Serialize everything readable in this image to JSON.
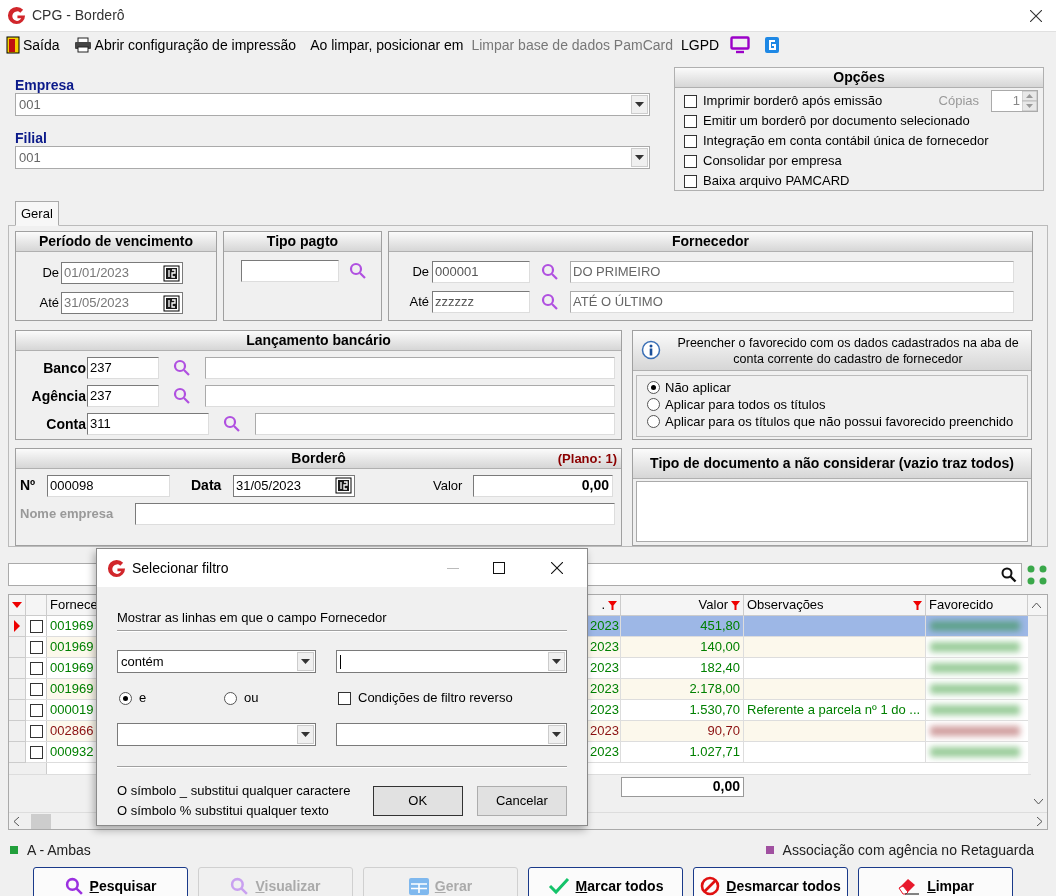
{
  "window": {
    "title": "CPG - Borderô"
  },
  "toolbar": [
    {
      "label": "Saída",
      "kind": "exit",
      "disabled": false
    },
    {
      "label": "Abrir configuração de impressão",
      "kind": "print",
      "disabled": false
    },
    {
      "label": "Ao limpar, posicionar em",
      "kind": "plain",
      "disabled": false
    },
    {
      "label": "Limpar base de dados PamCard",
      "kind": "plain",
      "disabled": true
    },
    {
      "label": "LGPD",
      "kind": "monitor",
      "disabled": false
    }
  ],
  "empresa": {
    "label": "Empresa",
    "value": "001"
  },
  "filial": {
    "label": "Filial",
    "value": "001"
  },
  "options": {
    "title": "Opções",
    "items": [
      {
        "label": "Imprimir borderô após emissão",
        "checked": false
      },
      {
        "label": "Emitir um borderô por documento selecionado",
        "checked": false
      },
      {
        "label": "Integração em conta contábil única de fornecedor",
        "checked": false
      },
      {
        "label": "Consolidar por empresa",
        "checked": false
      },
      {
        "label": "Baixa arquivo PAMCARD",
        "checked": false
      }
    ],
    "copies": {
      "label": "Cópias",
      "value": "1",
      "disabled": true
    }
  },
  "tabs": [
    {
      "label": "Geral",
      "selected": true
    }
  ],
  "periodo": {
    "title": "Período de vencimento",
    "rows": [
      {
        "label": "De",
        "value": "01/01/2023"
      },
      {
        "label": "Até",
        "value": "31/05/2023"
      }
    ]
  },
  "tipo_pagto": {
    "title": "Tipo pagto"
  },
  "fornecedor": {
    "title": "Fornecedor",
    "rows": [
      {
        "label": "De",
        "code": "000001",
        "name": "DO PRIMEIRO"
      },
      {
        "label": "Até",
        "code": "zzzzzz",
        "name": "ATÉ O ÚLTIMO"
      }
    ]
  },
  "lancamento": {
    "title": "Lançamento bancário",
    "rows": [
      {
        "label": "Banco",
        "value": "237"
      },
      {
        "label": "Agência",
        "value": "237"
      },
      {
        "label": "Conta",
        "value": "311"
      }
    ]
  },
  "favorecido": {
    "info": "Preencher o favorecido com os dados cadastrados na aba de conta corrente do cadastro de fornecedor",
    "options": [
      {
        "label": "Não aplicar",
        "selected": true
      },
      {
        "label": "Aplicar para todos os títulos",
        "selected": false
      },
      {
        "label": "Aplicar para os títulos que não possui favorecido preenchido",
        "selected": false
      }
    ]
  },
  "bordero": {
    "title": "Borderô",
    "plan": "(Plano: 1)",
    "number_label": "Nº",
    "number": "000098",
    "date_label": "Data",
    "date": "31/05/2023",
    "value_label": "Valor",
    "value": "0,00",
    "company_label": "Nome empresa"
  },
  "tipo_documento": {
    "title": "Tipo de documento a não considerar (vazio traz todos)"
  },
  "grid": {
    "columns": [
      {
        "label": "Fornece"
      },
      {
        "label": ".",
        "filter": true
      },
      {
        "label": "Valor",
        "filter": true
      },
      {
        "label": "Observações",
        "filter": true
      },
      {
        "label": "Favorecido",
        "filter": false
      }
    ],
    "rows": [
      {
        "supplier": "001969",
        "date": "2023",
        "value": "451,80",
        "color": "#008000",
        "selected": true,
        "checked": false
      },
      {
        "supplier": "001969",
        "date": "2023",
        "value": "140,00",
        "color": "#008000",
        "selected": false,
        "checked": false
      },
      {
        "supplier": "001969",
        "date": "2023",
        "value": "182,40",
        "color": "#008000",
        "selected": false,
        "checked": false
      },
      {
        "supplier": "001969",
        "date": "2023",
        "value": "2.178,00",
        "color": "#008000",
        "selected": false,
        "checked": false
      },
      {
        "supplier": "000019",
        "date": "2023",
        "value": "1.530,70",
        "notes": "Referente a parcela nº 1 do ...",
        "color": "#008000",
        "selected": false,
        "checked": false
      },
      {
        "supplier": "002866",
        "date": "2023",
        "value": "90,70",
        "color": "#8b1010",
        "selected": false,
        "checked": false
      },
      {
        "supplier": "000932",
        "date": "2023",
        "value": "1.027,71",
        "color": "#008000",
        "selected": false,
        "checked": false
      }
    ],
    "total": "0,00"
  },
  "legend": [
    {
      "label": "A - Ambas",
      "color": "#22a03c"
    },
    {
      "label": "Associação com agência no Retaguarda",
      "color": "#a050a0"
    }
  ],
  "buttons": [
    {
      "label": "Pesquisar",
      "kind": "search",
      "disabled": false
    },
    {
      "label": "Visualizar",
      "kind": "search",
      "disabled": true
    },
    {
      "label": "Gerar",
      "kind": "grid",
      "disabled": true
    },
    {
      "label": "Marcar todos",
      "kind": "check",
      "disabled": false
    },
    {
      "label": "Desmarcar todos",
      "kind": "forbid",
      "disabled": false
    },
    {
      "label": "Limpar",
      "kind": "eraser",
      "disabled": false
    }
  ],
  "dialog": {
    "title": "Selecionar filtro",
    "prompt": "Mostrar as linhas em que o campo Fornecedor",
    "condition": "contém",
    "logic": [
      {
        "label": "e",
        "selected": true
      },
      {
        "label": "ou",
        "selected": false
      }
    ],
    "reverse": {
      "label": "Condições de filtro reverso",
      "checked": false
    },
    "hints": [
      "O símbolo _ substitui qualquer caractere",
      "O símbolo % substitui qualquer texto"
    ],
    "buttons": [
      "OK",
      "Cancelar"
    ]
  }
}
